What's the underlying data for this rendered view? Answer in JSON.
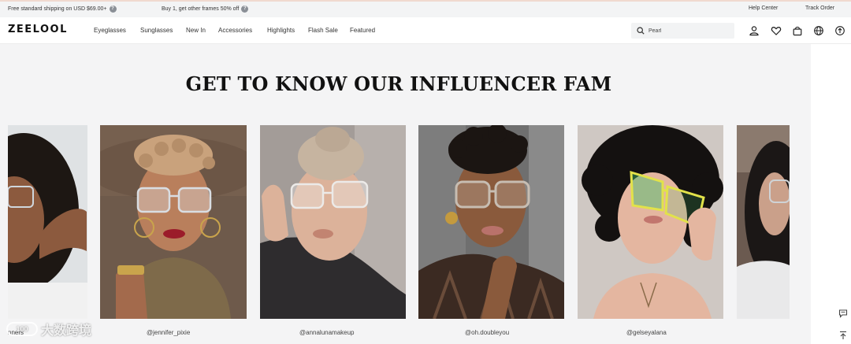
{
  "promo_bar": {
    "shipping_text": "Free standard shipping on USD $69.00+",
    "offer_text": "Buy 1, get other frames 50% off",
    "help_center": "Help Center",
    "track_order": "Track Order"
  },
  "nav": {
    "logo": "ZEELOOL",
    "items": [
      "Eyeglasses",
      "Sunglasses",
      "New In",
      "Accessories",
      "Highlights",
      "Flash Sale",
      "Featured"
    ],
    "search_value": "Pearl"
  },
  "section": {
    "title": "GET TO KNOW OUR INFLUENCER FAM"
  },
  "influencers": [
    {
      "handle": "@jennifer_pixie"
    },
    {
      "handle": "@annalunamakeup"
    },
    {
      "handle": "@oh.doubleyou"
    },
    {
      "handle": "@gelseyalana"
    }
  ],
  "partial_handle_left": "nners",
  "watermark": {
    "badge": "100",
    "text": "大数跨境"
  },
  "icons": [
    "info-icon",
    "search-icon",
    "user-icon",
    "heart-icon",
    "bag-icon",
    "globe-icon",
    "share-icon",
    "chat-icon",
    "back-to-top-icon"
  ],
  "colors": {
    "promo_bg": "#f3f4f5",
    "section_bg": "#f4f4f5",
    "heading": "#111111",
    "frame_yellow": "#e2e24a",
    "frame_green": "#3fbf6a"
  }
}
